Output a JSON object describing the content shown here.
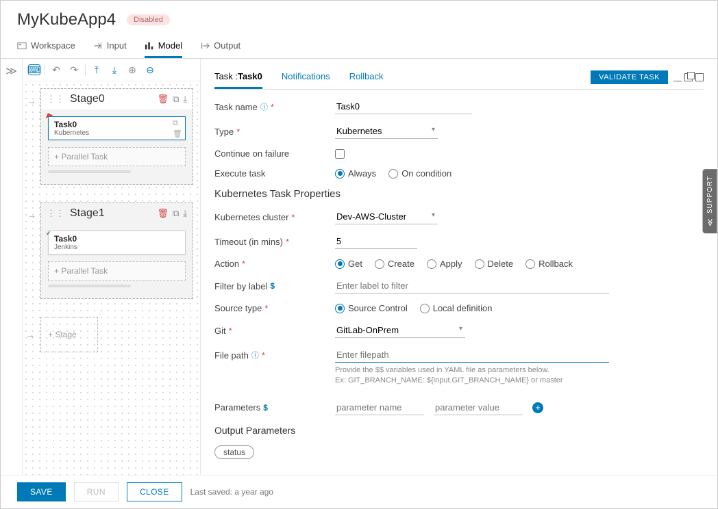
{
  "header": {
    "title": "MyKubeApp4",
    "status_badge": "Disabled"
  },
  "top_tabs": {
    "workspace": "Workspace",
    "input": "Input",
    "model": "Model",
    "output": "Output",
    "active": "model"
  },
  "canvas": {
    "stages": [
      {
        "name": "Stage0",
        "tasks": [
          {
            "name": "Task0",
            "type": "Kubernetes",
            "selected": true,
            "marker": "warn"
          }
        ]
      },
      {
        "name": "Stage1",
        "tasks": [
          {
            "name": "Task0",
            "type": "Jenkins",
            "selected": false,
            "marker": "ok"
          }
        ]
      }
    ],
    "parallel_task_label": "+ Parallel Task",
    "add_stage_label": "+ Stage"
  },
  "detail_tabs": {
    "task_prefix": "Task :",
    "task_name": "Task0",
    "notifications": "Notifications",
    "rollback": "Rollback",
    "validate_btn": "VALIDATE TASK"
  },
  "form": {
    "task_name_label": "Task name",
    "task_name_value": "Task0",
    "type_label": "Type",
    "type_value": "Kubernetes",
    "continue_label": "Continue on failure",
    "execute_label": "Execute task",
    "execute_options": {
      "always": "Always",
      "on_condition": "On condition"
    },
    "section_k8s": "Kubernetes Task Properties",
    "cluster_label": "Kubernetes cluster",
    "cluster_value": "Dev-AWS-Cluster",
    "timeout_label": "Timeout (in mins)",
    "timeout_value": "5",
    "action_label": "Action",
    "action_options": {
      "get": "Get",
      "create": "Create",
      "apply": "Apply",
      "delete": "Delete",
      "rollback": "Rollback"
    },
    "filter_label": "Filter by label",
    "filter_placeholder": "Enter label to filter",
    "source_type_label": "Source type",
    "source_type_options": {
      "scm": "Source Control",
      "local": "Local definition"
    },
    "git_label": "Git",
    "git_value": "GitLab-OnPrem",
    "file_path_label": "File path",
    "file_path_placeholder": "Enter filepath",
    "file_path_hint1": "Provide the $$ variables used in YAML file as parameters below.",
    "file_path_hint2": "Ex: GIT_BRANCH_NAME: ${input.GIT_BRANCH_NAME} or master",
    "params_label": "Parameters",
    "param_name_placeholder": "parameter name",
    "param_value_placeholder": "parameter value",
    "output_params_label": "Output Parameters",
    "output_chip": "status"
  },
  "footer": {
    "save": "SAVE",
    "run": "RUN",
    "close": "CLOSE",
    "last_saved": "Last saved: a year ago"
  },
  "support_tab": "SUPPORT"
}
